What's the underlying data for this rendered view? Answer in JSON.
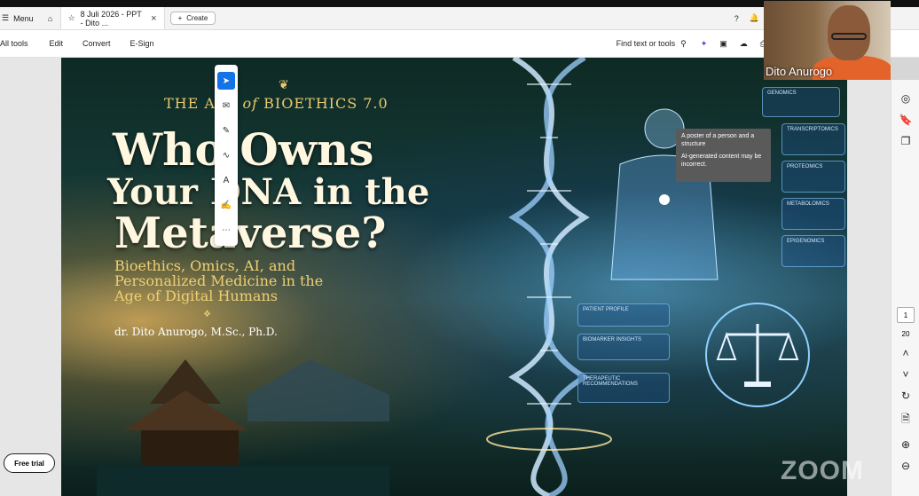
{
  "tabbar": {
    "menu_label": "Menu",
    "tab_title": "8 Juli 2026 - PPT - Dito ...",
    "create_label": "Create"
  },
  "toolbar": {
    "all_tools": "All tools",
    "edit": "Edit",
    "convert": "Convert",
    "esign": "E-Sign",
    "find_label": "Find text or tools"
  },
  "slide": {
    "tagline_prefix": "THE A",
    "tagline_mid": "of",
    "tagline_suffix": "BIOETHICS 7.0",
    "title_line1": "Who Owns",
    "title_line2": "Your DNA in the",
    "title_line3": "Metaverse?",
    "subtitle_line1": "Bioethics, Omics, AI, and",
    "subtitle_line2": "Personalized Medicine in the",
    "subtitle_line3": "Age of Digital Humans",
    "author": "dr. Dito Anurogo, M.Sc., Ph.D.",
    "hud_labels": [
      "GENOMICS",
      "TRANSCRIPTOMICS",
      "PROTEOMICS",
      "METABOLOMICS",
      "EPIGENOMICS",
      "PATIENT PROFILE",
      "BIOMARKER INSIGHTS",
      "THERAPEUTIC RECOMMENDATIONS"
    ]
  },
  "tooltip": {
    "line1": "A poster of a person and a structure",
    "line2": "AI-generated content may be incorrect."
  },
  "webcam": {
    "name": "Dito Anurogo"
  },
  "pager": {
    "current": "1",
    "total": "20"
  },
  "free_trial": "Free trial",
  "watermark": "ZOOM"
}
